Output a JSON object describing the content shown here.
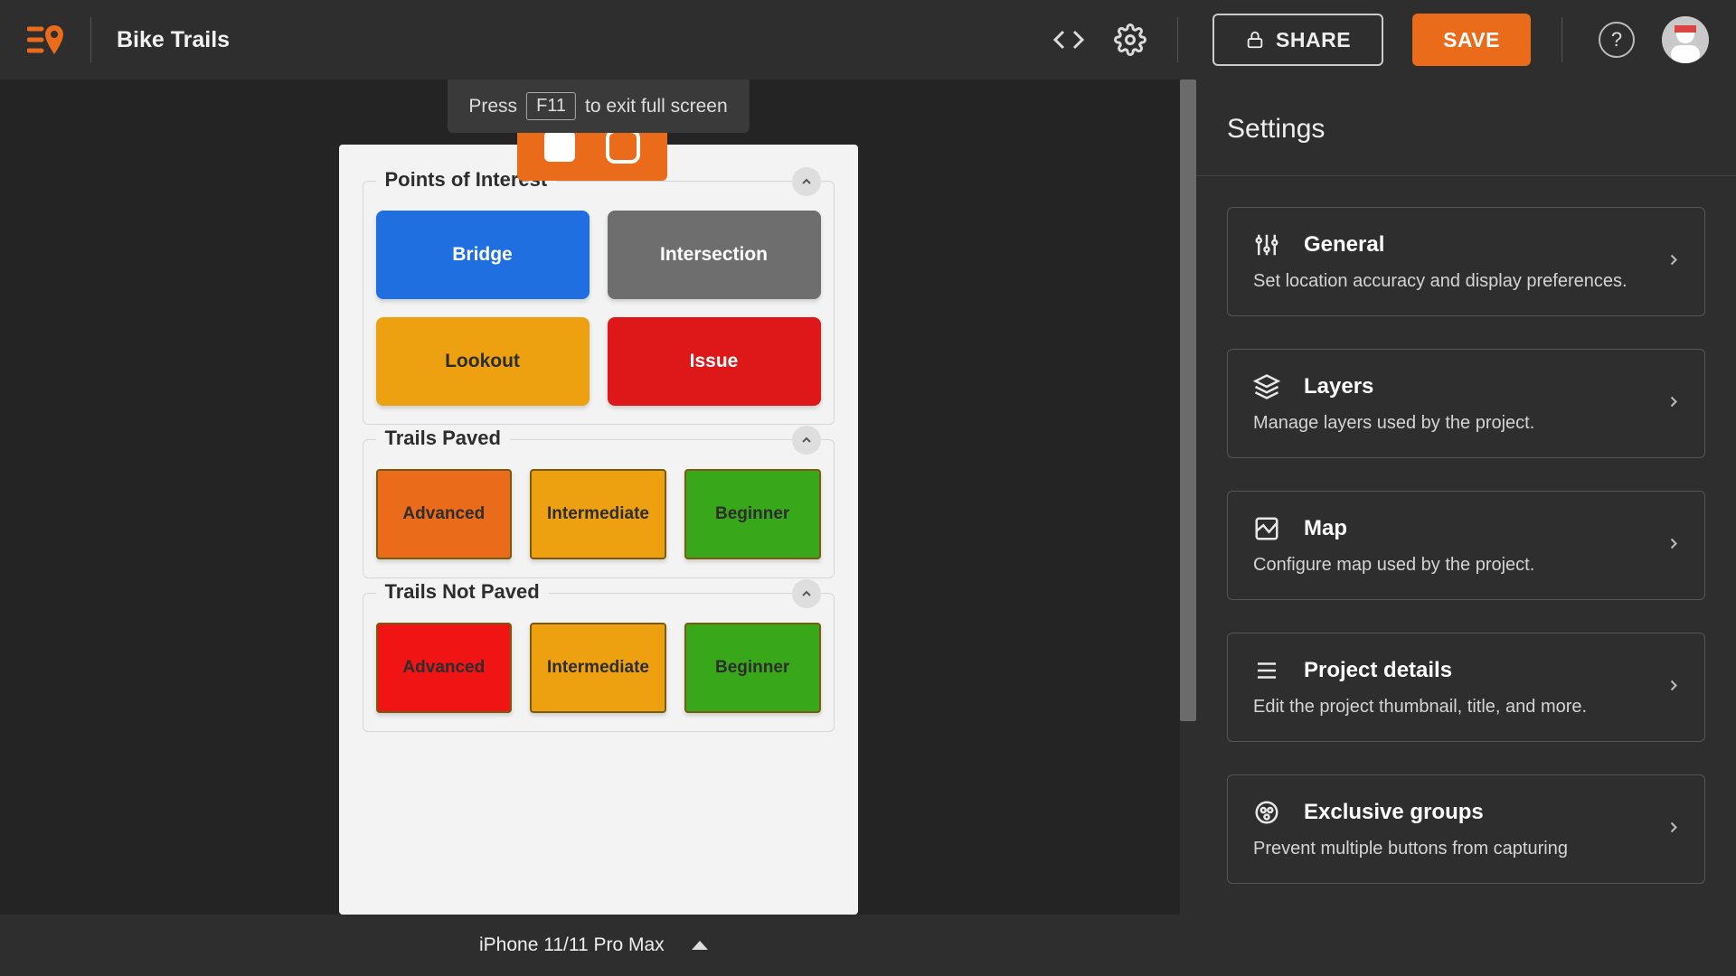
{
  "header": {
    "title": "Bike Trails",
    "share_label": "SHARE",
    "save_label": "SAVE"
  },
  "fullscreen_hint": {
    "prefix": "Press",
    "key": "F11",
    "suffix": "to exit full screen"
  },
  "preview": {
    "panels": [
      {
        "title": "Points of Interest",
        "layout": "grid2",
        "tiles": [
          {
            "label": "Bridge",
            "bg": "#1f6fe0",
            "fg": "#ffffff"
          },
          {
            "label": "Intersection",
            "bg": "#6e6e6e",
            "fg": "#ffffff"
          },
          {
            "label": "Lookout",
            "bg": "#eda010",
            "fg": "#2d2d2d"
          },
          {
            "label": "Issue",
            "bg": "#de1818",
            "fg": "#ffffff"
          }
        ]
      },
      {
        "title": "Trails Paved",
        "layout": "grid3",
        "tiles": [
          {
            "label": "Advanced",
            "bg": "#ea6b1a",
            "fg": "#2d2d2d",
            "bordered": true
          },
          {
            "label": "Intermediate",
            "bg": "#eda010",
            "fg": "#2d2d2d",
            "bordered": true
          },
          {
            "label": "Beginner",
            "bg": "#38a71a",
            "fg": "#2d2d2d",
            "bordered": true
          }
        ]
      },
      {
        "title": "Trails Not Paved",
        "layout": "grid3",
        "tiles": [
          {
            "label": "Advanced",
            "bg": "#f01414",
            "fg": "#2d2d2d",
            "bordered": true
          },
          {
            "label": "Intermediate",
            "bg": "#eda010",
            "fg": "#2d2d2d",
            "bordered": true
          },
          {
            "label": "Beginner",
            "bg": "#38a71a",
            "fg": "#2d2d2d",
            "bordered": true
          }
        ]
      }
    ]
  },
  "settings": {
    "heading": "Settings",
    "cards": [
      {
        "icon": "sliders",
        "title": "General",
        "desc": "Set location accuracy and display preferences."
      },
      {
        "icon": "layers",
        "title": "Layers",
        "desc": "Manage layers used by the project."
      },
      {
        "icon": "map",
        "title": "Map",
        "desc": "Configure map used by the project."
      },
      {
        "icon": "details",
        "title": "Project details",
        "desc": "Edit the project thumbnail, title, and more."
      },
      {
        "icon": "groups",
        "title": "Exclusive groups",
        "desc": "Prevent multiple buttons from capturing"
      }
    ]
  },
  "bottom": {
    "device_label": "iPhone 11/11 Pro Max"
  }
}
